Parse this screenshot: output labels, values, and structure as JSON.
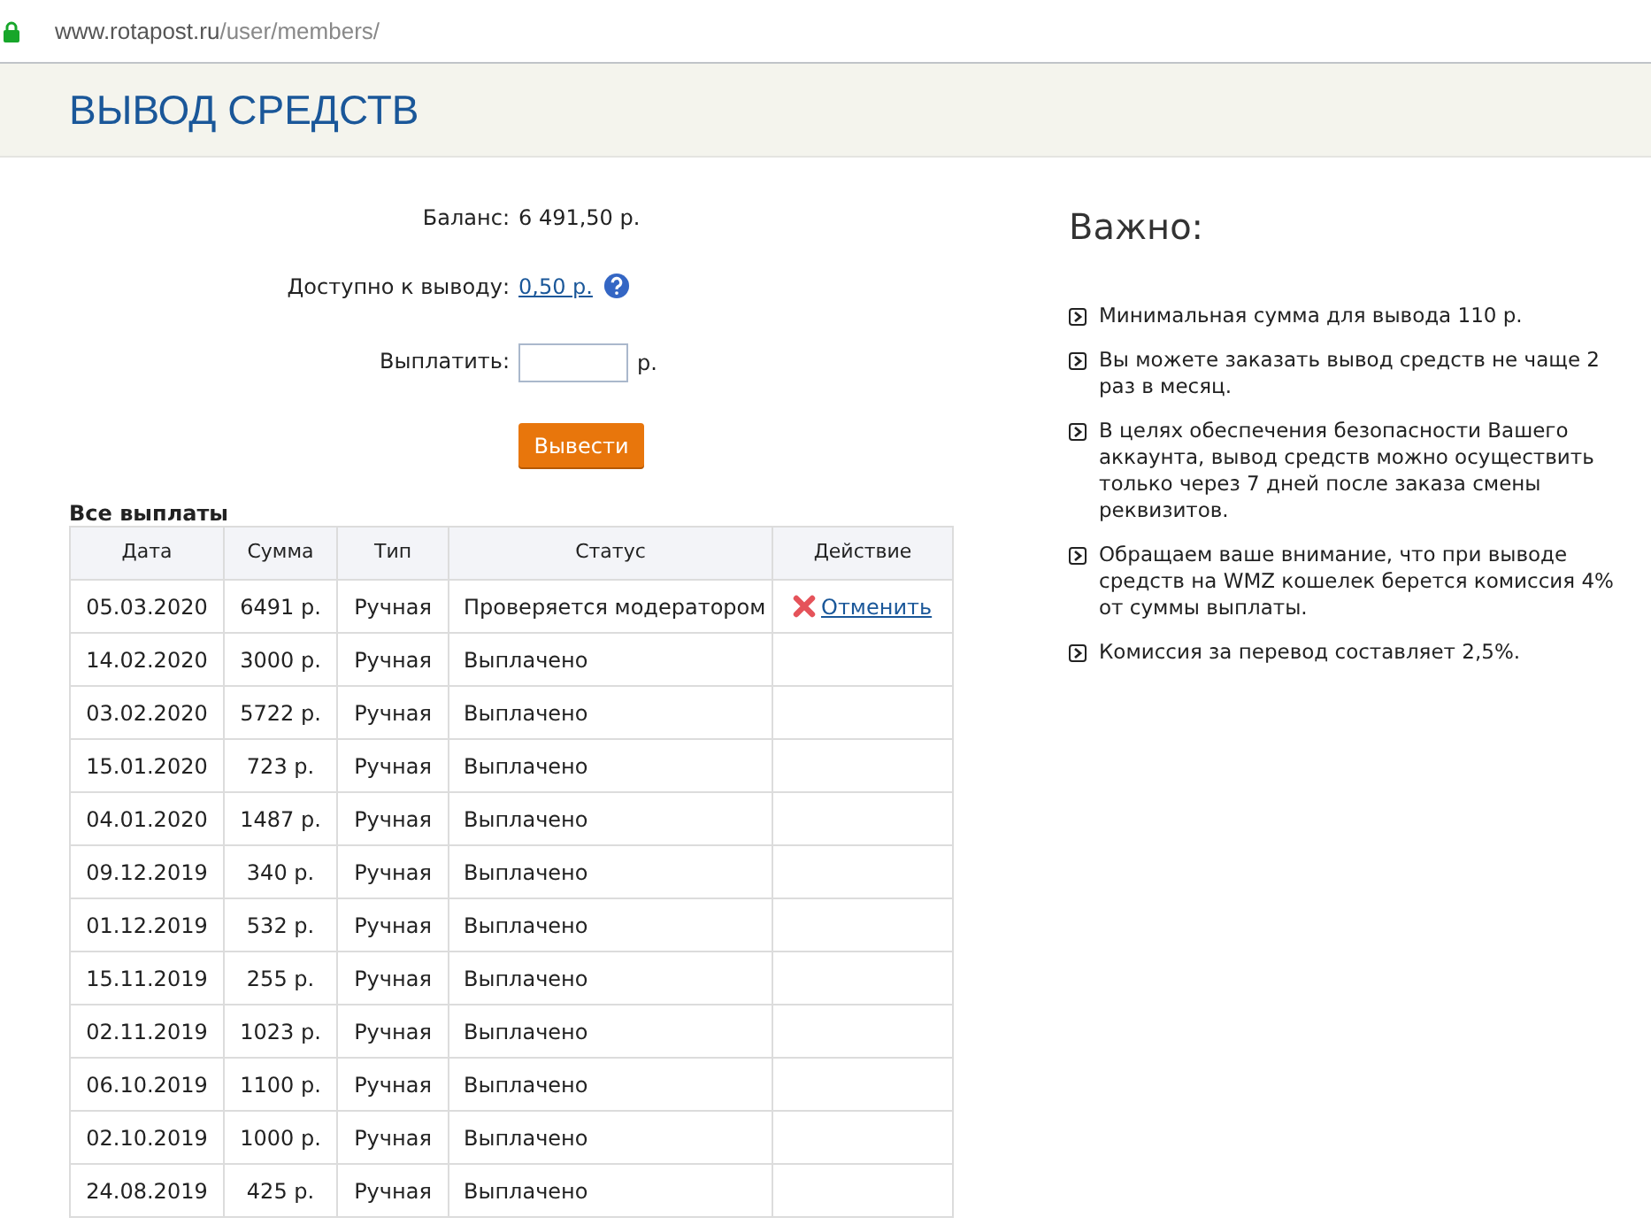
{
  "address_bar": {
    "host": "www.rotapost.ru",
    "path": "/user/members/"
  },
  "page_title": "ВЫВОД СРЕДСТВ",
  "form": {
    "balance_label": "Баланс:",
    "balance_value": "6 491,50 р.",
    "available_label": "Доступно к выводу:",
    "available_value": "0,50 р.",
    "pay_label": "Выплатить:",
    "pay_unit": "р.",
    "submit": "Вывести"
  },
  "table": {
    "title": "Все выплаты",
    "columns": [
      "Дата",
      "Сумма",
      "Тип",
      "Статус",
      "Действие"
    ],
    "rows": [
      {
        "date": "05.03.2020",
        "sum": "6491 р.",
        "type": "Ручная",
        "status": "Проверяется модератором",
        "action": "Отменить"
      },
      {
        "date": "14.02.2020",
        "sum": "3000 р.",
        "type": "Ручная",
        "status": "Выплачено"
      },
      {
        "date": "03.02.2020",
        "sum": "5722 р.",
        "type": "Ручная",
        "status": "Выплачено"
      },
      {
        "date": "15.01.2020",
        "sum": "723 р.",
        "type": "Ручная",
        "status": "Выплачено"
      },
      {
        "date": "04.01.2020",
        "sum": "1487 р.",
        "type": "Ручная",
        "status": "Выплачено"
      },
      {
        "date": "09.12.2019",
        "sum": "340 р.",
        "type": "Ручная",
        "status": "Выплачено"
      },
      {
        "date": "01.12.2019",
        "sum": "532 р.",
        "type": "Ручная",
        "status": "Выплачено"
      },
      {
        "date": "15.11.2019",
        "sum": "255 р.",
        "type": "Ручная",
        "status": "Выплачено"
      },
      {
        "date": "02.11.2019",
        "sum": "1023 р.",
        "type": "Ручная",
        "status": "Выплачено"
      },
      {
        "date": "06.10.2019",
        "sum": "1100 р.",
        "type": "Ручная",
        "status": "Выплачено"
      },
      {
        "date": "02.10.2019",
        "sum": "1000 р.",
        "type": "Ручная",
        "status": "Выплачено"
      },
      {
        "date": "24.08.2019",
        "sum": "425 р.",
        "type": "Ручная",
        "status": "Выплачено"
      }
    ]
  },
  "important": {
    "title": "Важно:",
    "items": [
      "Минимальная сумма для вывода 110 р.",
      "Вы можете заказать вывод средств не чаще 2 раз в месяц.",
      "В целях обеспечения безопасности Вашего аккаунта, вывод средств можно осуществить только через 7 дней после заказа смены реквизитов.",
      "Обращаем ваше внимание, что при выводе средств на WMZ кошелек берется комиссия 4% от суммы выплаты.",
      "Комиссия за перевод составляет 2,5%."
    ]
  }
}
